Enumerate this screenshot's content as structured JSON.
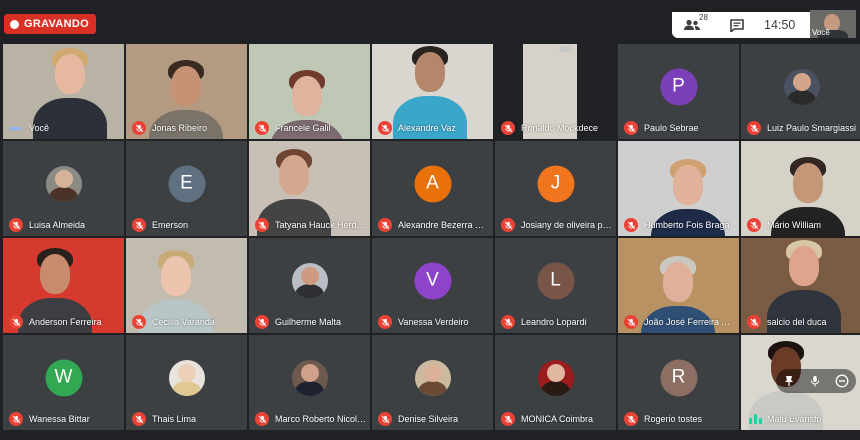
{
  "recording": {
    "label": "GRAVANDO"
  },
  "controls": {
    "participants_count": "28",
    "time": "14:50",
    "self_label": "Você"
  },
  "tiles": [
    {
      "name": "Você",
      "type": "video",
      "muted": false,
      "self": true
    },
    {
      "name": "Jonas Ribeiro",
      "type": "video",
      "muted": true
    },
    {
      "name": "Francele Galil",
      "type": "video",
      "muted": true
    },
    {
      "name": "Alexandre Vaz",
      "type": "video",
      "muted": true
    },
    {
      "name": "Ronaldo Mockdece",
      "type": "video",
      "muted": true
    },
    {
      "name": "Paulo Sebrae",
      "type": "letter",
      "initial": "P",
      "color": "#7b3fb8",
      "muted": true
    },
    {
      "name": "Luiz Paulo Smargiassi",
      "type": "photo",
      "muted": true
    },
    {
      "name": "Luisa Almeida",
      "type": "photo",
      "muted": true
    },
    {
      "name": "Emerson",
      "type": "letter",
      "initial": "E",
      "color": "#5f7180",
      "muted": true
    },
    {
      "name": "Tatyana Hauck Herdy ...",
      "type": "video",
      "muted": true
    },
    {
      "name": "Alexandre Bezerra Mor...",
      "type": "letter",
      "initial": "A",
      "color": "#e8710a",
      "muted": true
    },
    {
      "name": "Josiany de oliveira pinh...",
      "type": "letter",
      "initial": "J",
      "color": "#f0761e",
      "muted": true
    },
    {
      "name": "Humberto Fois Braga",
      "type": "video",
      "muted": true
    },
    {
      "name": "Mário William",
      "type": "video",
      "muted": true
    },
    {
      "name": "Anderson Ferreira",
      "type": "video",
      "muted": true
    },
    {
      "name": "Cecilia Varanda",
      "type": "video",
      "muted": true
    },
    {
      "name": "Guilherme Malta",
      "type": "photo",
      "muted": true
    },
    {
      "name": "Vanessa Verdeiro",
      "type": "letter",
      "initial": "V",
      "color": "#8e44c8",
      "muted": true
    },
    {
      "name": "Leandro Lopardi",
      "type": "letter",
      "initial": "L",
      "color": "#795548",
      "muted": true
    },
    {
      "name": "João José Ferreira Alves",
      "type": "video",
      "muted": true
    },
    {
      "name": "salcio del duca",
      "type": "video",
      "muted": true
    },
    {
      "name": "Wanessa Bittar",
      "type": "letter",
      "initial": "W",
      "color": "#33a852",
      "muted": true
    },
    {
      "name": "Thais Lima",
      "type": "photo",
      "muted": true
    },
    {
      "name": "Marco Roberto Nicolau",
      "type": "photo",
      "muted": true
    },
    {
      "name": "Denise Silveira",
      "type": "photo",
      "muted": true
    },
    {
      "name": "MONICA Coimbra",
      "type": "photo",
      "muted": true
    },
    {
      "name": "Rogerio tostes",
      "type": "letter",
      "initial": "R",
      "color": "#8d6e63",
      "muted": true
    },
    {
      "name": "Malu Evaristo",
      "type": "video",
      "muted": false,
      "speaking": true
    }
  ],
  "icons": {
    "record": "record-dot-icon",
    "participants": "people-icon",
    "chat": "chat-icon",
    "mic_off": "mic-off-icon",
    "pin": "pin-icon",
    "mic": "mic-icon",
    "remove": "remove-icon",
    "more": "more-options-icon"
  }
}
